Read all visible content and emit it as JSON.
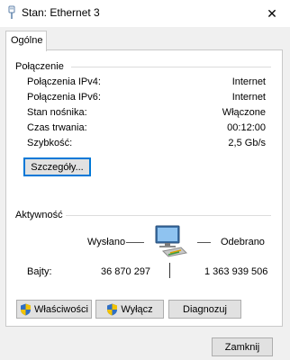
{
  "window": {
    "title": "Stan: Ethernet 3",
    "close_glyph": "✕"
  },
  "tabs": [
    {
      "label": "Ogólne"
    }
  ],
  "connection": {
    "title": "Połączenie",
    "rows": [
      {
        "label": "Połączenia IPv4:",
        "value": "Internet"
      },
      {
        "label": "Połączenia IPv6:",
        "value": "Internet"
      },
      {
        "label": "Stan nośnika:",
        "value": "Włączone"
      },
      {
        "label": "Czas trwania:",
        "value": "00:12:00"
      },
      {
        "label": "Szybkość:",
        "value": "2,5 Gb/s"
      }
    ],
    "details_button": "Szczegóły..."
  },
  "activity": {
    "title": "Aktywność",
    "sent_label": "Wysłano",
    "received_label": "Odebrano",
    "bytes_label": "Bajty:",
    "bytes_sent": "36 870 297",
    "bytes_received": "1 363 939 506"
  },
  "buttons": {
    "properties": "Właściwości",
    "disable": "Wyłącz",
    "diagnose": "Diagnozuj",
    "close": "Zamknij"
  },
  "colors": {
    "accent": "#0078d7",
    "shield_blue": "#2f6fc4",
    "shield_yellow": "#f2c200"
  }
}
